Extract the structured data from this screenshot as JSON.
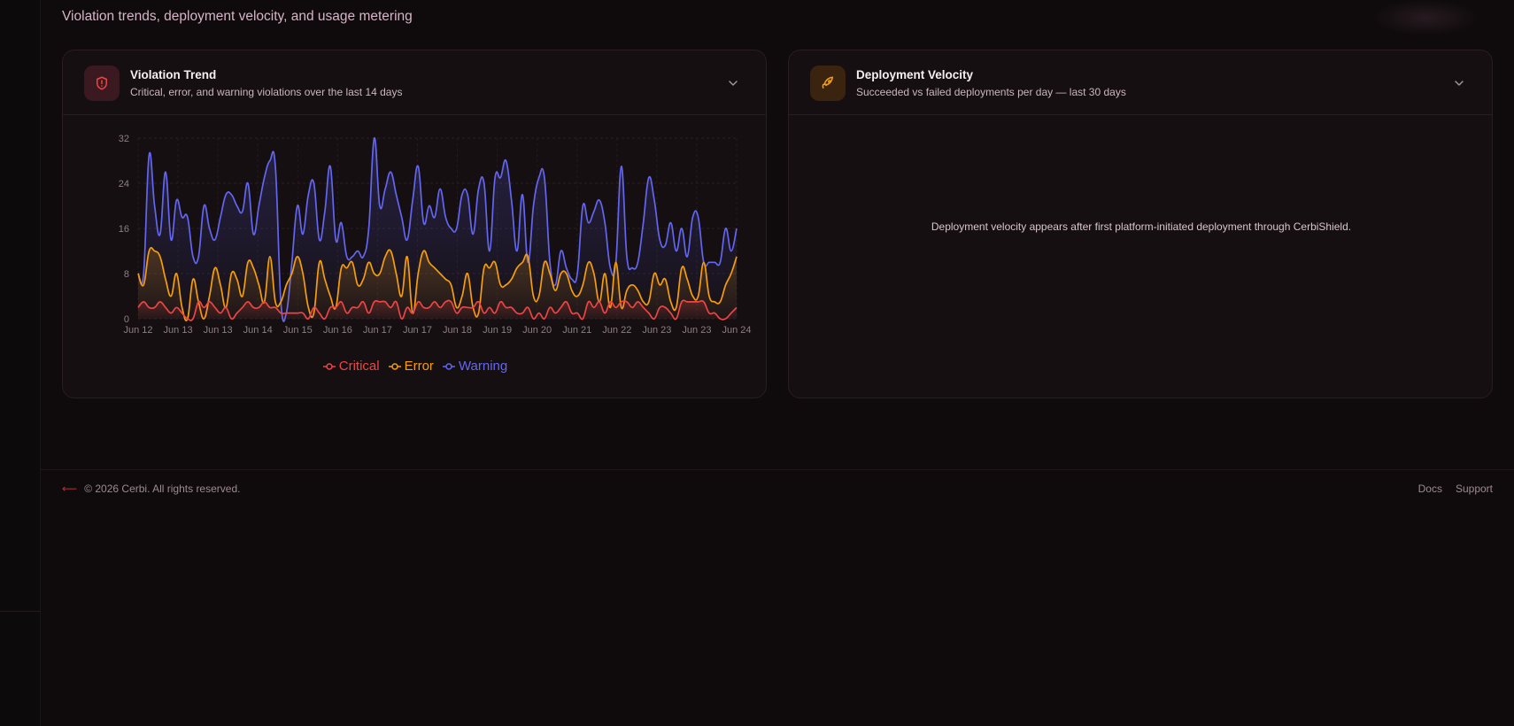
{
  "header": {
    "subtitle": "Violation trends, deployment velocity, and usage metering"
  },
  "violation_card": {
    "title": "Violation Trend",
    "description": "Critical, error, and warning violations over the last 14 days",
    "icon": "shield-alert-icon"
  },
  "deployment_card": {
    "title": "Deployment Velocity",
    "description": "Succeeded vs failed deployments per day — last 30 days",
    "icon": "rocket-icon",
    "empty_message": "Deployment velocity appears after first platform-initiated deployment through CerbiShield."
  },
  "footer": {
    "copyright": "© 2026 Cerbi. All rights reserved.",
    "links": [
      "Docs",
      "Support"
    ]
  },
  "colors": {
    "critical": "#ef4444",
    "error": "#f59e0b",
    "warning": "#6366f1"
  },
  "chart_data": {
    "type": "line",
    "ylim": [
      0,
      32
    ],
    "yticks": [
      "0",
      "8",
      "16",
      "24",
      "32"
    ],
    "x_tick_labels": [
      "Jun 12",
      "Jun 13",
      "Jun 13",
      "Jun 14",
      "Jun 15",
      "Jun 16",
      "Jun 17",
      "Jun 17",
      "Jun 18",
      "Jun 19",
      "Jun 20",
      "Jun 21",
      "Jun 22",
      "Jun 23",
      "Jun 23",
      "Jun 24"
    ],
    "legend_position": "bottom",
    "series": [
      {
        "name": "Critical",
        "color": "#ef4444",
        "values": [
          2,
          3,
          2,
          2,
          3,
          2,
          1,
          2,
          1,
          0,
          0,
          3,
          2,
          3,
          2,
          1,
          2,
          0,
          1,
          2,
          3,
          2,
          2,
          3,
          2,
          2,
          1,
          1,
          1,
          1,
          1,
          0,
          2,
          1,
          0,
          2,
          2,
          3,
          1,
          2,
          2,
          3,
          1,
          3,
          3,
          3,
          2,
          3,
          0,
          2,
          1,
          3,
          2,
          2,
          3,
          2,
          3,
          3,
          1,
          2,
          2,
          2,
          3,
          1,
          2,
          1,
          3,
          2,
          2,
          1,
          1,
          2,
          0,
          1,
          0,
          2,
          1,
          2,
          3,
          1,
          1,
          0,
          3,
          2,
          3,
          1,
          3,
          2,
          3,
          3,
          2,
          3,
          2,
          1,
          0,
          2,
          2,
          1,
          0,
          3,
          3,
          3,
          3,
          3,
          1,
          1,
          0,
          0,
          1,
          2
        ]
      },
      {
        "name": "Error",
        "color": "#f59e0b",
        "values": [
          8,
          6,
          12,
          12,
          11,
          7,
          4,
          8,
          2,
          0,
          7,
          3,
          0,
          4,
          9,
          6,
          2,
          8,
          7,
          4,
          10,
          9,
          6,
          3,
          11,
          3,
          3,
          6,
          8,
          11,
          8,
          2,
          1,
          10,
          7,
          4,
          2,
          9,
          9,
          10,
          6,
          7,
          10,
          8,
          8,
          11,
          12,
          8,
          4,
          11,
          1,
          8,
          12,
          10,
          9,
          8,
          7,
          6,
          2,
          4,
          8,
          2,
          1,
          9,
          9,
          10,
          6,
          6,
          7,
          9,
          10,
          11,
          4,
          4,
          10,
          8,
          5,
          8,
          8,
          5,
          4,
          6,
          10,
          8,
          3,
          8,
          2,
          10,
          2,
          5,
          6,
          5,
          3,
          3,
          8,
          6,
          7,
          3,
          2,
          9,
          7,
          4,
          4,
          10,
          4,
          3,
          3,
          6,
          8,
          11
        ]
      },
      {
        "name": "Warning",
        "color": "#6366f1",
        "values": [
          8,
          8,
          29,
          20,
          15,
          26,
          14,
          21,
          18,
          18,
          11,
          11,
          20,
          16,
          14,
          18,
          22,
          22,
          20,
          19,
          24,
          15,
          20,
          25,
          28,
          27,
          3,
          1,
          10,
          20,
          15,
          22,
          24,
          14,
          19,
          27,
          14,
          17,
          11,
          11,
          12,
          11,
          16,
          32,
          20,
          23,
          26,
          22,
          18,
          14,
          21,
          27,
          17,
          20,
          18,
          23,
          18,
          16,
          16,
          22,
          22,
          15,
          23,
          24,
          12,
          25,
          25,
          28,
          21,
          12,
          22,
          10,
          20,
          25,
          25,
          10,
          6,
          12,
          9,
          7,
          8,
          20,
          17,
          19,
          21,
          17,
          9,
          10,
          27,
          11,
          9,
          10,
          17,
          25,
          21,
          14,
          13,
          17,
          12,
          16,
          11,
          18,
          18,
          10,
          10,
          10,
          10,
          16,
          12,
          16
        ]
      }
    ]
  }
}
